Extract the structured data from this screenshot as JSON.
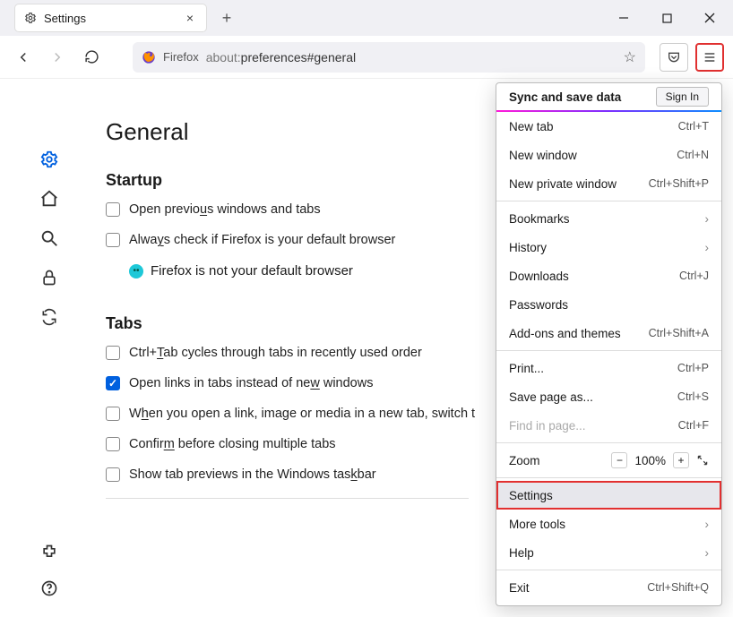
{
  "window": {
    "tab_title": "Settings",
    "firefox_label": "Firefox",
    "url_prefix": "about:",
    "url_rest": "preferences#general"
  },
  "nav": {
    "search_placeholder": ""
  },
  "page": {
    "title": "General",
    "startup": {
      "heading": "Startup",
      "open_prev_pre": "Open previo",
      "open_prev_u": "u",
      "open_prev_post": "s windows and tabs",
      "always_check_pre": "Alwa",
      "always_check_u": "y",
      "always_check_post": "s check if Firefox is your default browser",
      "status": "Firefox is not your default browser"
    },
    "tabs": {
      "heading": "Tabs",
      "ctrl_tab_pre": "Ctrl+",
      "ctrl_tab_u": "T",
      "ctrl_tab_post": "ab cycles through tabs in recently used order",
      "open_links_pre": "Open links in tabs instead of ne",
      "open_links_u": "w",
      "open_links_post": " windows",
      "switch_pre": "W",
      "switch_u": "h",
      "switch_post": "en you open a link, image or media in a new tab, switch t",
      "confirm_pre": "Confir",
      "confirm_u": "m",
      "confirm_post": " before closing multiple tabs",
      "previews_pre": "Show tab previews in the Windows tas",
      "previews_u": "k",
      "previews_post": "bar"
    }
  },
  "menu": {
    "sync_title": "Sync and save data",
    "signin": "Sign In",
    "new_tab": "New tab",
    "new_tab_s": "Ctrl+T",
    "new_window": "New window",
    "new_window_s": "Ctrl+N",
    "new_private": "New private window",
    "new_private_s": "Ctrl+Shift+P",
    "bookmarks": "Bookmarks",
    "history": "History",
    "downloads": "Downloads",
    "downloads_s": "Ctrl+J",
    "passwords": "Passwords",
    "addons": "Add-ons and themes",
    "addons_s": "Ctrl+Shift+A",
    "print": "Print...",
    "print_s": "Ctrl+P",
    "save_as": "Save page as...",
    "save_as_s": "Ctrl+S",
    "find": "Find in page...",
    "find_s": "Ctrl+F",
    "zoom": "Zoom",
    "zoom_val": "100%",
    "settings": "Settings",
    "more_tools": "More tools",
    "help": "Help",
    "exit": "Exit",
    "exit_s": "Ctrl+Shift+Q"
  }
}
